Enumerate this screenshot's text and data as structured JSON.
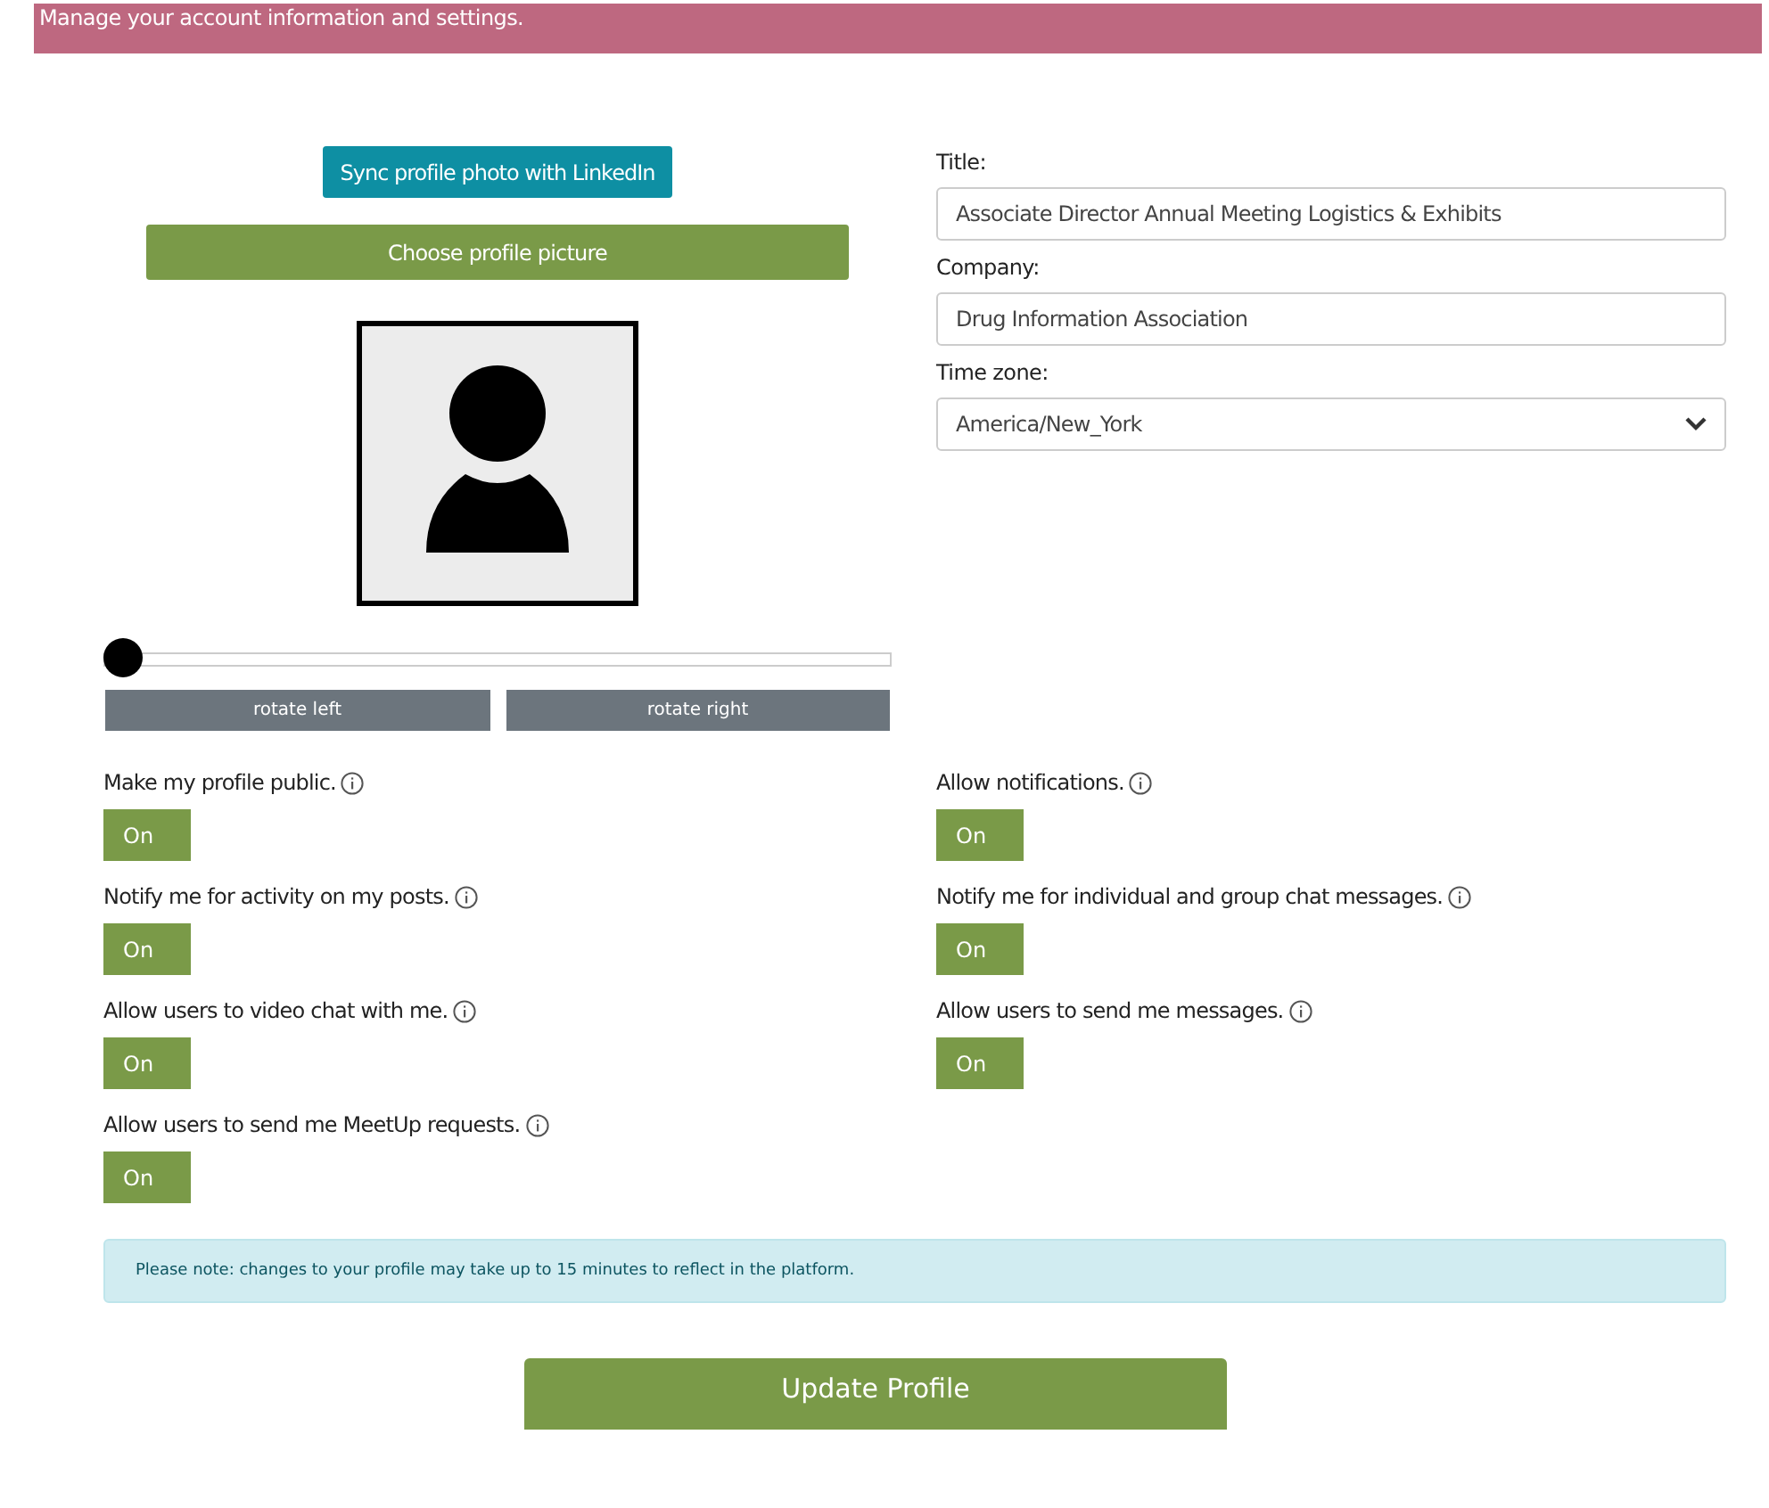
{
  "banner": {
    "text": "Manage your account information and settings."
  },
  "photo": {
    "sync_button": "Sync profile photo with LinkedIn",
    "choose_button": "Choose profile picture",
    "zoom": {
      "level": 0
    },
    "rotate_buttons": [
      "rotate left",
      "rotate right"
    ]
  },
  "fields": [
    {
      "kind": "text",
      "label": "Title:",
      "value": "Associate Director Annual Meeting Logistics & Exhibits"
    },
    {
      "kind": "text",
      "label": "Company:",
      "value": "Drug Information Association"
    },
    {
      "kind": "select",
      "label": "Time zone:",
      "value": "America/New_York"
    }
  ],
  "toggles": [
    {
      "label": "Make my profile public.",
      "state": "On",
      "on": true
    },
    {
      "label": "Allow notifications.",
      "state": "On",
      "on": true
    },
    {
      "label": "Notify me for activity on my posts.",
      "state": "On",
      "on": true
    },
    {
      "label": "Notify me for individual and group chat messages.",
      "state": "On",
      "on": true
    },
    {
      "label": "Allow users to video chat with me.",
      "state": "On",
      "on": true
    },
    {
      "label": "Allow users to send me messages.",
      "state": "On",
      "on": true
    },
    {
      "label": "Allow users to send me MeetUp requests.",
      "state": "On",
      "on": true
    }
  ],
  "note": "Please note: changes to your profile may take up to 15 minutes to reflect in the platform.",
  "submit_button": "Update Profile"
}
